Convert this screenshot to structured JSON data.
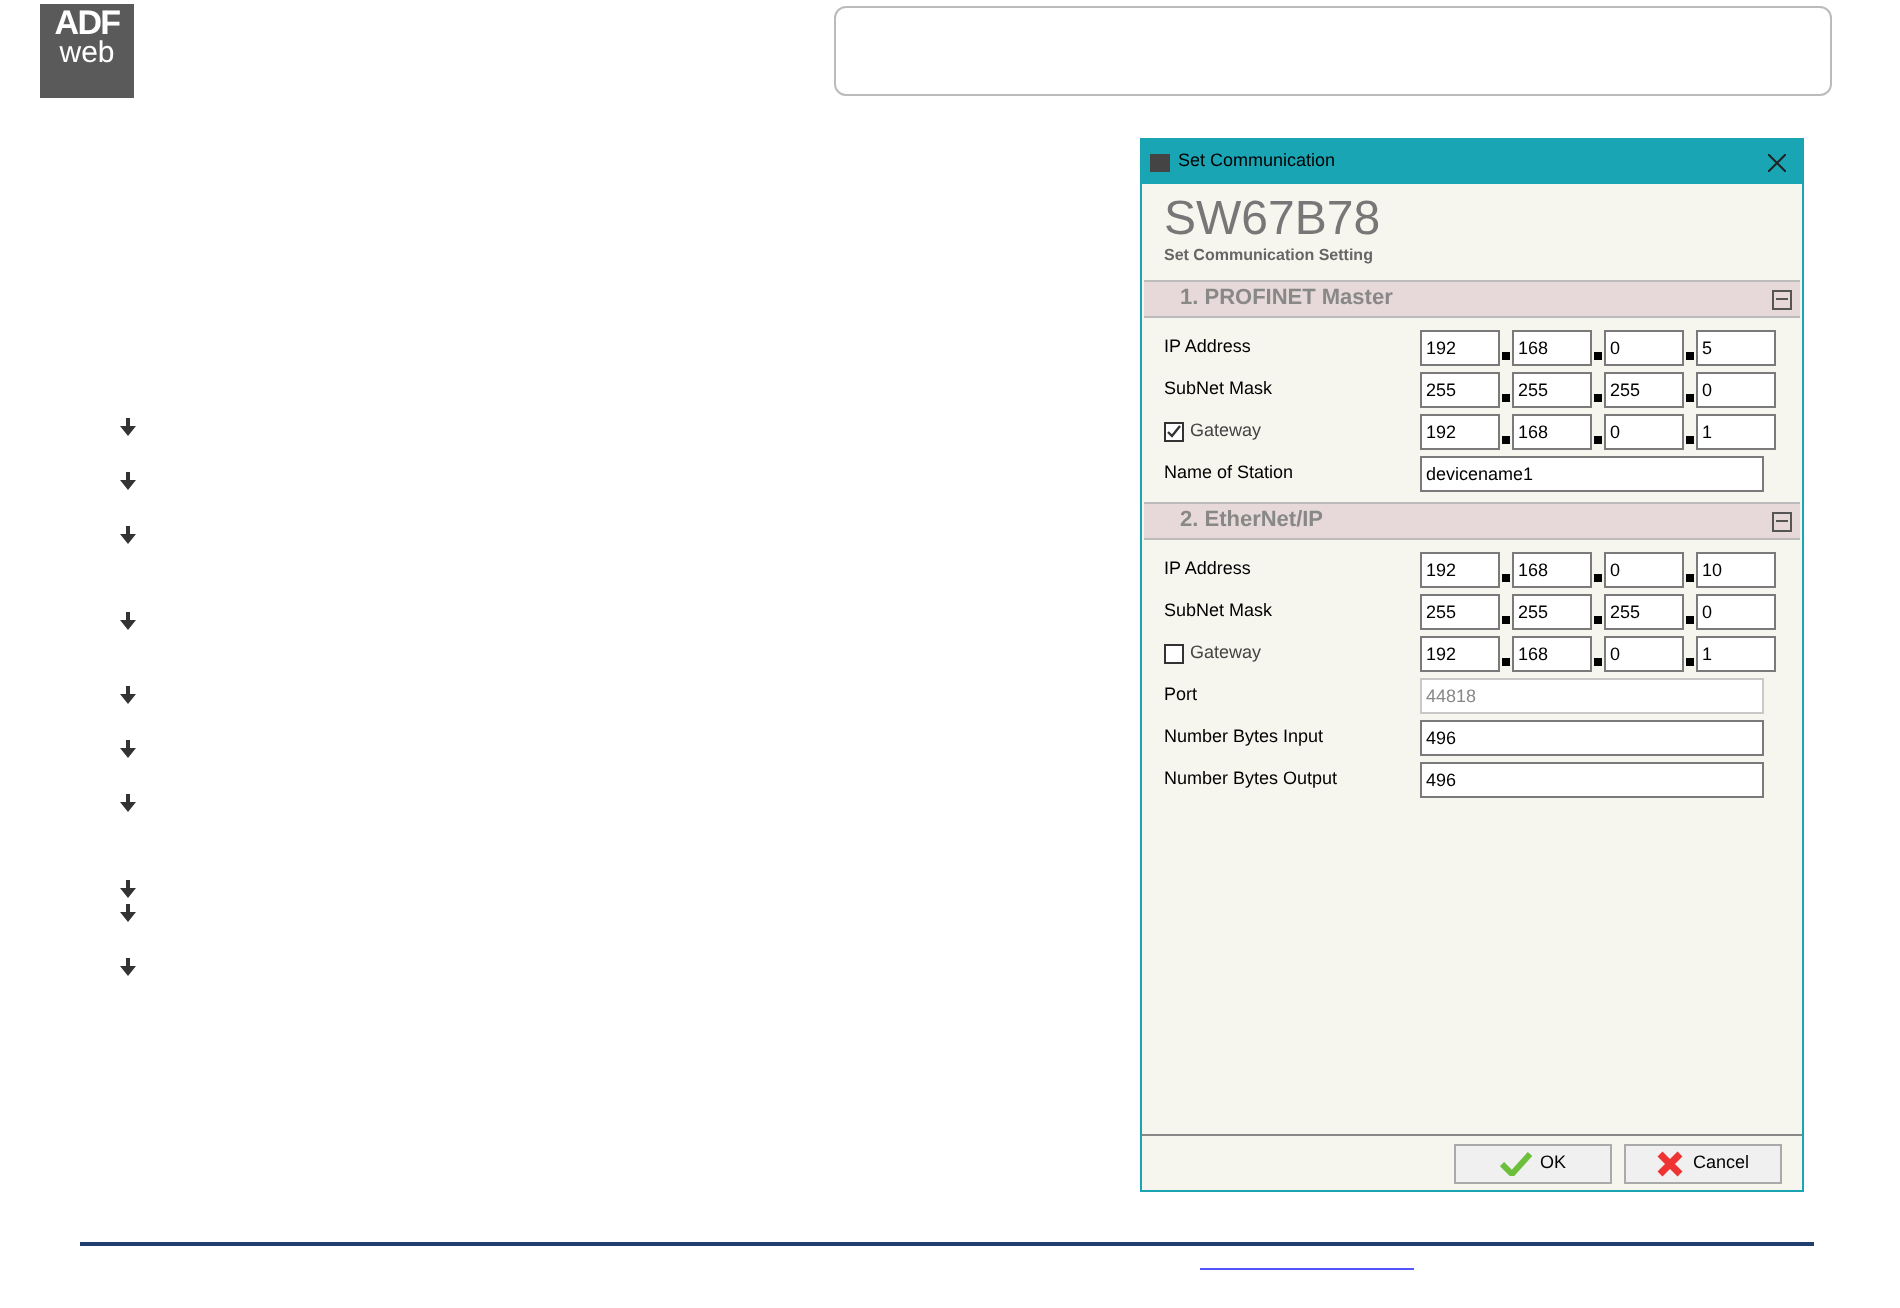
{
  "logo": {
    "top": "ADF",
    "bottom": "web"
  },
  "bullets": [
    {
      "kind": "arrow"
    },
    {
      "kind": "arrow"
    },
    {
      "kind": "arrow"
    },
    {
      "kind": "arrow"
    },
    {
      "kind": "arrow"
    },
    {
      "kind": "arrow"
    },
    {
      "kind": "arrow"
    },
    {
      "kind": "arrow"
    },
    {
      "kind": "arrow"
    },
    {
      "kind": "arrow"
    }
  ],
  "dialog": {
    "title": "Set Communication",
    "heading": "SW67B78",
    "subheading": "Set Communication Setting",
    "sections": [
      {
        "title": "1. PROFINET Master",
        "expanded": true,
        "rows": [
          {
            "kind": "ip",
            "label": "IP Address",
            "octets": [
              "192",
              "168",
              "0",
              "5"
            ]
          },
          {
            "kind": "ip",
            "label": "SubNet Mask",
            "octets": [
              "255",
              "255",
              "255",
              "0"
            ]
          },
          {
            "kind": "ip_check",
            "label": "Gateway",
            "checked": true,
            "octets": [
              "192",
              "168",
              "0",
              "1"
            ]
          },
          {
            "kind": "text",
            "label": "Name of Station",
            "value": "devicename1",
            "disabled": false
          }
        ]
      },
      {
        "title": "2. EtherNet/IP",
        "expanded": true,
        "rows": [
          {
            "kind": "ip",
            "label": "IP Address",
            "octets": [
              "192",
              "168",
              "0",
              "10"
            ]
          },
          {
            "kind": "ip",
            "label": "SubNet Mask",
            "octets": [
              "255",
              "255",
              "255",
              "0"
            ]
          },
          {
            "kind": "ip_check",
            "label": "Gateway",
            "checked": false,
            "octets": [
              "192",
              "168",
              "0",
              "1"
            ]
          },
          {
            "kind": "text",
            "label": "Port",
            "value": "44818",
            "disabled": true
          },
          {
            "kind": "text",
            "label": "Number Bytes Input",
            "value": "496",
            "disabled": false
          },
          {
            "kind": "text",
            "label": "Number Bytes Output",
            "value": "496",
            "disabled": false
          }
        ]
      }
    ],
    "buttons": [
      {
        "kind": "ok",
        "label": "OK"
      },
      {
        "kind": "cancel",
        "label": "Cancel"
      }
    ]
  }
}
